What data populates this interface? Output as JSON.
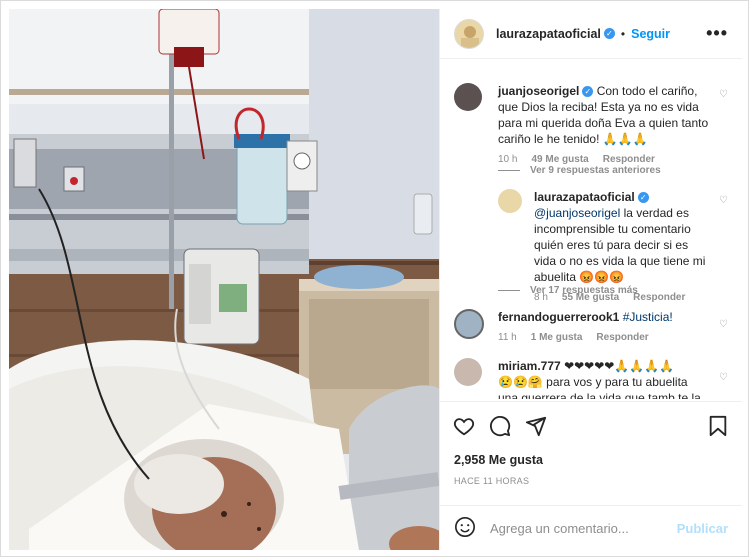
{
  "post": {
    "author": "laurazapataoficial",
    "follow_label": "Seguir",
    "more_label": "•••"
  },
  "comments": [
    {
      "user": "juanjoseorigel",
      "text": "Con todo el cariño, que Dios la reciba! Esta ya no es vida para mi querida doña Eva a quien tanto cariño le he tenido! 🙏🙏🙏",
      "time": "10 h",
      "likes": "49 Me gusta",
      "reply": "Responder"
    },
    {
      "view_replies": "Ver 9 respuestas anteriores"
    },
    {
      "user": "laurazapataoficial",
      "mention": "@juanjoseorigel",
      "text": "la verdad es incomprensible tu comentario quién eres tú para decir si es vida o no es vida la que tiene mi abuelita 😡😡😡",
      "time": "8 h",
      "likes": "55 Me gusta",
      "reply": "Responder"
    },
    {
      "view_replies": "Ver 17 respuestas más"
    },
    {
      "user": "fernandoguerrerook1",
      "hashtag": "#Justicia!",
      "time": "11 h",
      "likes": "1 Me gusta",
      "reply": "Responder"
    },
    {
      "user": "miriam.777",
      "text_line1": "❤❤❤❤❤🙏🙏🙏🙏",
      "text_line2": "😢😢🤗 para vos y para tu abuelita  una guerrera de la vida  que tamb te la tomo"
    }
  ],
  "footer": {
    "likes": "2,958 Me gusta",
    "time_ago": "HACE 11 HORAS",
    "add_comment_placeholder": "Agrega un comentario...",
    "publish_label": "Publicar"
  },
  "icons": [
    "heart-icon",
    "comment-icon",
    "share-icon",
    "bookmark-icon",
    "emoji-icon",
    "verified-icon",
    "more-icon"
  ],
  "colors": {
    "accent": "#0095f6",
    "verified": "#3897f0",
    "muted": "#8e8e8e",
    "publish_disabled": "#b2dffc"
  }
}
